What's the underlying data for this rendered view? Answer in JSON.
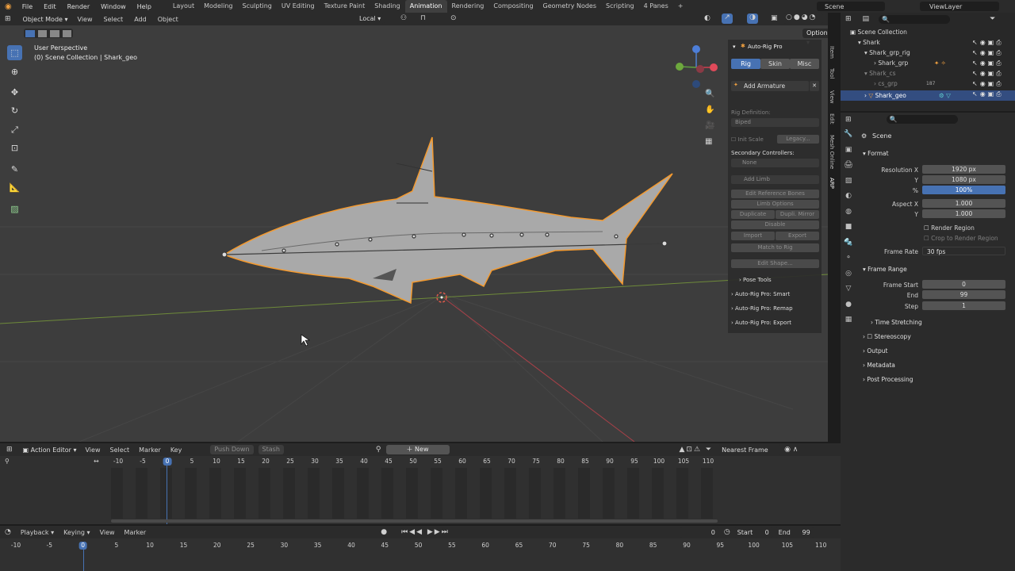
{
  "topbar": {
    "menus": [
      "File",
      "Edit",
      "Render",
      "Window",
      "Help"
    ],
    "workspaces": [
      "Layout",
      "Modeling",
      "Sculpting",
      "UV Editing",
      "Texture Paint",
      "Shading",
      "Animation",
      "Rendering",
      "Compositing",
      "Geometry Nodes",
      "Scripting",
      "4 Panes"
    ],
    "active_workspace": "Animation",
    "scene": "Scene",
    "view_layer": "ViewLayer"
  },
  "viewport": {
    "mode": "Object Mode",
    "menus": [
      "View",
      "Select",
      "Add",
      "Object"
    ],
    "orientation": "Local",
    "options": "Options",
    "perspective": "User Perspective",
    "collection_info": "(0) Scene Collection | Shark_geo"
  },
  "npanel": {
    "title": "Auto-Rig Pro",
    "tabs": [
      "Rig",
      "Skin",
      "Misc"
    ],
    "active_tab": "Rig",
    "add_armature": "Add Armature",
    "rig_definition": "Rig Definition:",
    "biped": "Biped",
    "init_scale": "Init Scale",
    "legacy": "Legacy...",
    "secondary": "Secondary Controllers:",
    "none": "None",
    "add_limb": "Add Limb",
    "edit_ref": "Edit Reference Bones",
    "limb_options": "Limb Options",
    "duplicate": "Duplicate",
    "dupli_mirror": "Dupli. Mirror",
    "disable": "Disable",
    "import": "Import",
    "export": "Export",
    "match": "Match to Rig",
    "edit_shape": "Edit Shape...",
    "pose_tools": "Pose Tools",
    "smart": "Auto-Rig Pro: Smart",
    "remap": "Auto-Rig Pro: Remap",
    "arp_export": "Auto-Rig Pro: Export",
    "vtabs": [
      "Item",
      "Tool",
      "View",
      "Edit",
      "Mesh Online",
      "ARP"
    ]
  },
  "outliner": {
    "root": "Scene Collection",
    "rows": [
      {
        "label": "Shark",
        "indent": 1
      },
      {
        "label": "Shark_grp_rig",
        "indent": 2
      },
      {
        "label": "Shark_grp",
        "indent": 3
      },
      {
        "label": "Shark_cs",
        "indent": 2
      },
      {
        "label": "cs_grp",
        "indent": 3
      },
      {
        "label": "Shark_geo",
        "indent": 2
      }
    ],
    "badge": "187"
  },
  "props": {
    "scene": "Scene",
    "format": "Format",
    "res_x_label": "Resolution X",
    "res_x": "1920 px",
    "y_label": "Y",
    "res_y": "1080 px",
    "pct_label": "%",
    "pct": "100%",
    "aspect_label": "Aspect X",
    "aspect_x": "1.000",
    "aspect_y": "1.000",
    "render_region": "Render Region",
    "crop": "Crop to Render Region",
    "frame_rate_label": "Frame Rate",
    "frame_rate": "30 fps",
    "frame_range": "Frame Range",
    "frame_start_label": "Frame Start",
    "frame_start": "0",
    "end_label": "End",
    "end": "99",
    "step_label": "Step",
    "step": "1",
    "time_stretching": "Time Stretching",
    "stereoscopy": "Stereoscopy",
    "output": "Output",
    "metadata": "Metadata",
    "post": "Post Processing"
  },
  "action": {
    "editor": "Action Editor",
    "menus": [
      "View",
      "Select",
      "Marker",
      "Key"
    ],
    "push_down": "Push Down",
    "stash": "Stash",
    "new": "New",
    "snap": "Nearest Frame",
    "ticks": [
      "-10",
      "-5",
      "0",
      "5",
      "10",
      "15",
      "20",
      "25",
      "30",
      "35",
      "40",
      "45",
      "50",
      "55",
      "60",
      "65",
      "70",
      "75",
      "80",
      "85",
      "90",
      "95",
      "100",
      "105",
      "110"
    ],
    "current": "0"
  },
  "timeline": {
    "menus": [
      "Playback",
      "Keying",
      "View",
      "Marker"
    ],
    "frame": "0",
    "start_label": "Start",
    "start": "0",
    "end_label": "End",
    "end": "99",
    "ticks": [
      "-10",
      "-5",
      "0",
      "5",
      "10",
      "15",
      "20",
      "25",
      "30",
      "35",
      "40",
      "45",
      "50",
      "55",
      "60",
      "65",
      "70",
      "75",
      "80",
      "85",
      "90",
      "95",
      "100",
      "105",
      "110"
    ],
    "current": "0"
  },
  "colors": {
    "accent": "#4772b3",
    "selection": "#f49a2f",
    "x_axis": "#c8434c",
    "y_axis": "#7ea33c"
  }
}
